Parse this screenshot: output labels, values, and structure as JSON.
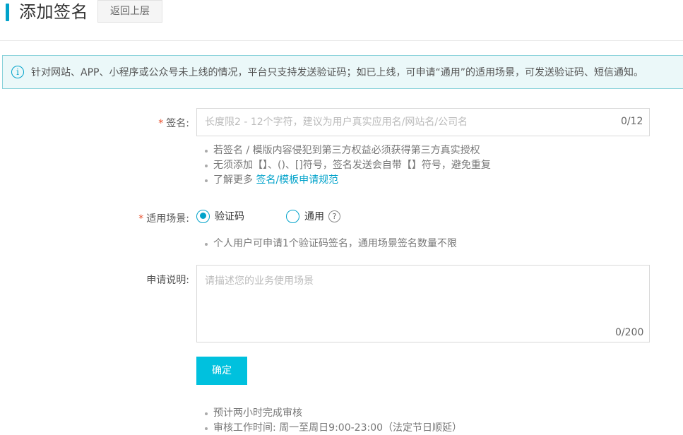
{
  "header": {
    "title": "添加签名",
    "back_label": "返回上层"
  },
  "notice": {
    "icon": "info-icon",
    "icon_glyph": "i",
    "text": "针对网站、APP、小程序或公众号未上线的情况，平台只支持发送验证码；如已上线，可申请“通用”的适用场景，可发送验证码、短信通知。"
  },
  "form": {
    "required_mark": "*",
    "signature": {
      "label": "签名:",
      "placeholder": "长度限2 - 12个字符，建议为用户真实应用名/网站名/公司名",
      "value": "",
      "counter": "0/12",
      "hints": [
        "若签名 / 模版内容侵犯到第三方权益必须获得第三方真实授权",
        "无须添加【】、()、[]符号，签名发送会自带【】符号，避免重复"
      ],
      "hint_link_prefix": "了解更多 ",
      "hint_link_text": "签名/模板申请规范"
    },
    "scene": {
      "label": "适用场景:",
      "options": [
        {
          "label": "验证码",
          "checked": true
        },
        {
          "label": "通用",
          "checked": false
        }
      ],
      "help_glyph": "?",
      "hint": "个人用户可申请1个验证码签名，通用场景签名数量不限"
    },
    "description": {
      "label": "申请说明:",
      "placeholder": "请描述您的业务使用场景",
      "value": "",
      "counter": "0/200"
    },
    "confirm_label": "确定",
    "footer_hints": [
      "预计两小时完成审核",
      "审核工作时间: 周一至周日9:00-23:00（法定节日顺延）"
    ]
  },
  "colors": {
    "accent": "#00a2ca",
    "button": "#00c1de",
    "required": "#e84e2b",
    "notice_bg": "#ebf8f9",
    "notice_border": "#88d1da"
  }
}
